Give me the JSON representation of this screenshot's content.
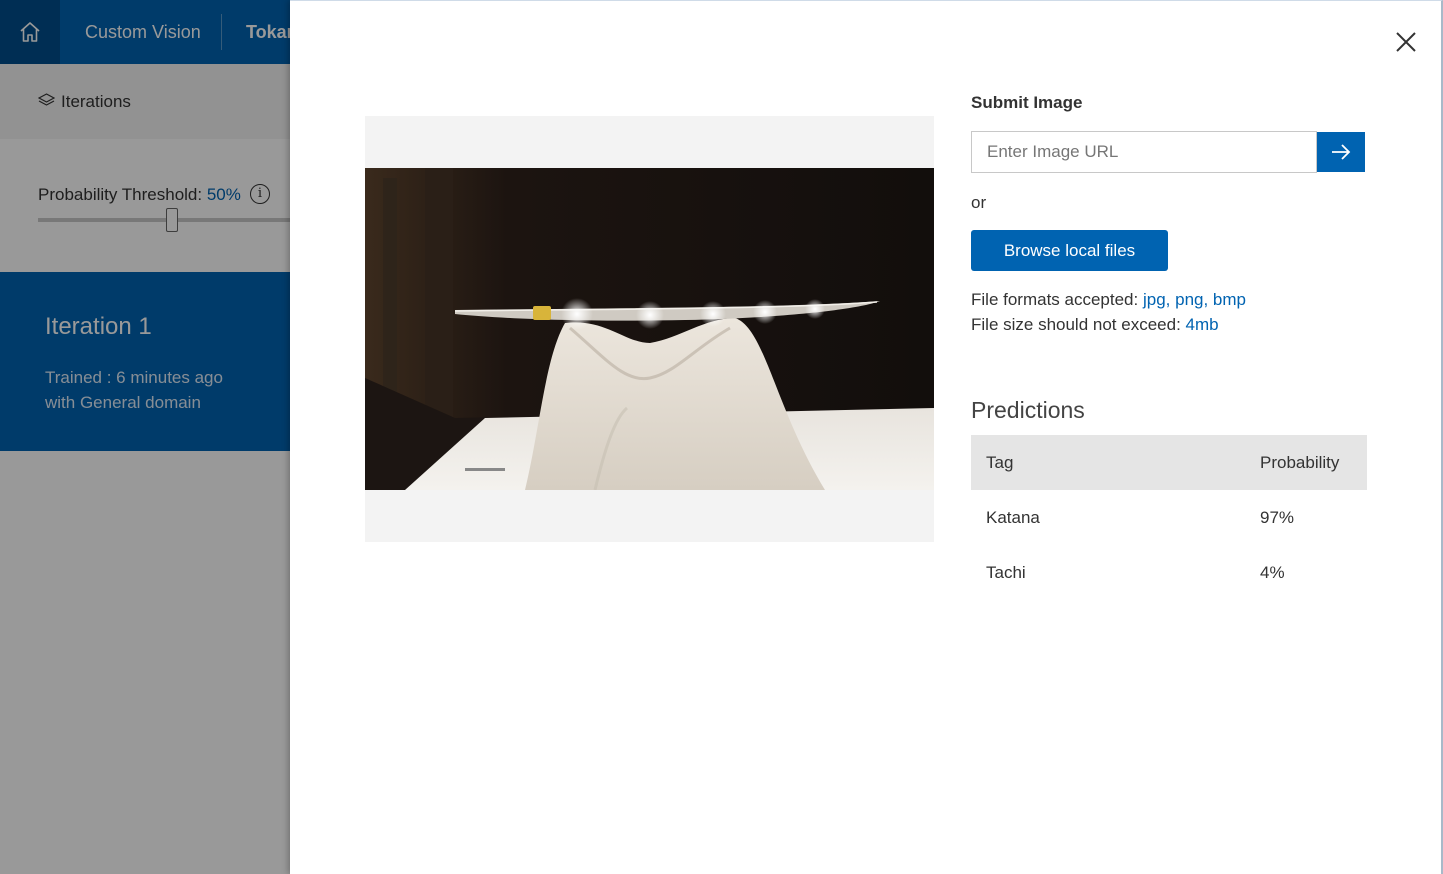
{
  "topbar": {
    "home_icon": "home-icon",
    "app_name": "Custom Vision",
    "project_name": "Tokan"
  },
  "left_panel": {
    "iterations_label": "Iterations",
    "iterations_icon": "layers-icon",
    "threshold_label": "Probability Threshold:",
    "threshold_value": "50%",
    "threshold_fraction": 0.5,
    "info_icon": "info-icon",
    "iteration_title": "Iteration 1",
    "iteration_trained": "Trained : 6 minutes ago",
    "iteration_domain": "with General domain"
  },
  "dialog": {
    "close_icon": "close-icon",
    "submit_title": "Submit Image",
    "url_placeholder": "Enter Image URL",
    "go_icon": "arrow-right-icon",
    "or_text": "or",
    "browse_label": "Browse local files",
    "formats_label": "File formats accepted:",
    "formats_value": "jpg, png, bmp",
    "size_label": "File size should not exceed:",
    "size_value": "4mb",
    "predictions_title": "Predictions",
    "columns": {
      "tag": "Tag",
      "probability": "Probability"
    },
    "predictions": [
      {
        "tag": "Katana",
        "probability": "97%"
      },
      {
        "tag": "Tachi",
        "probability": "4%"
      }
    ]
  },
  "colors": {
    "accent": "#0063b1",
    "accent_dark": "#004e8c",
    "overlay": "rgba(0,0,0,0.40)"
  }
}
